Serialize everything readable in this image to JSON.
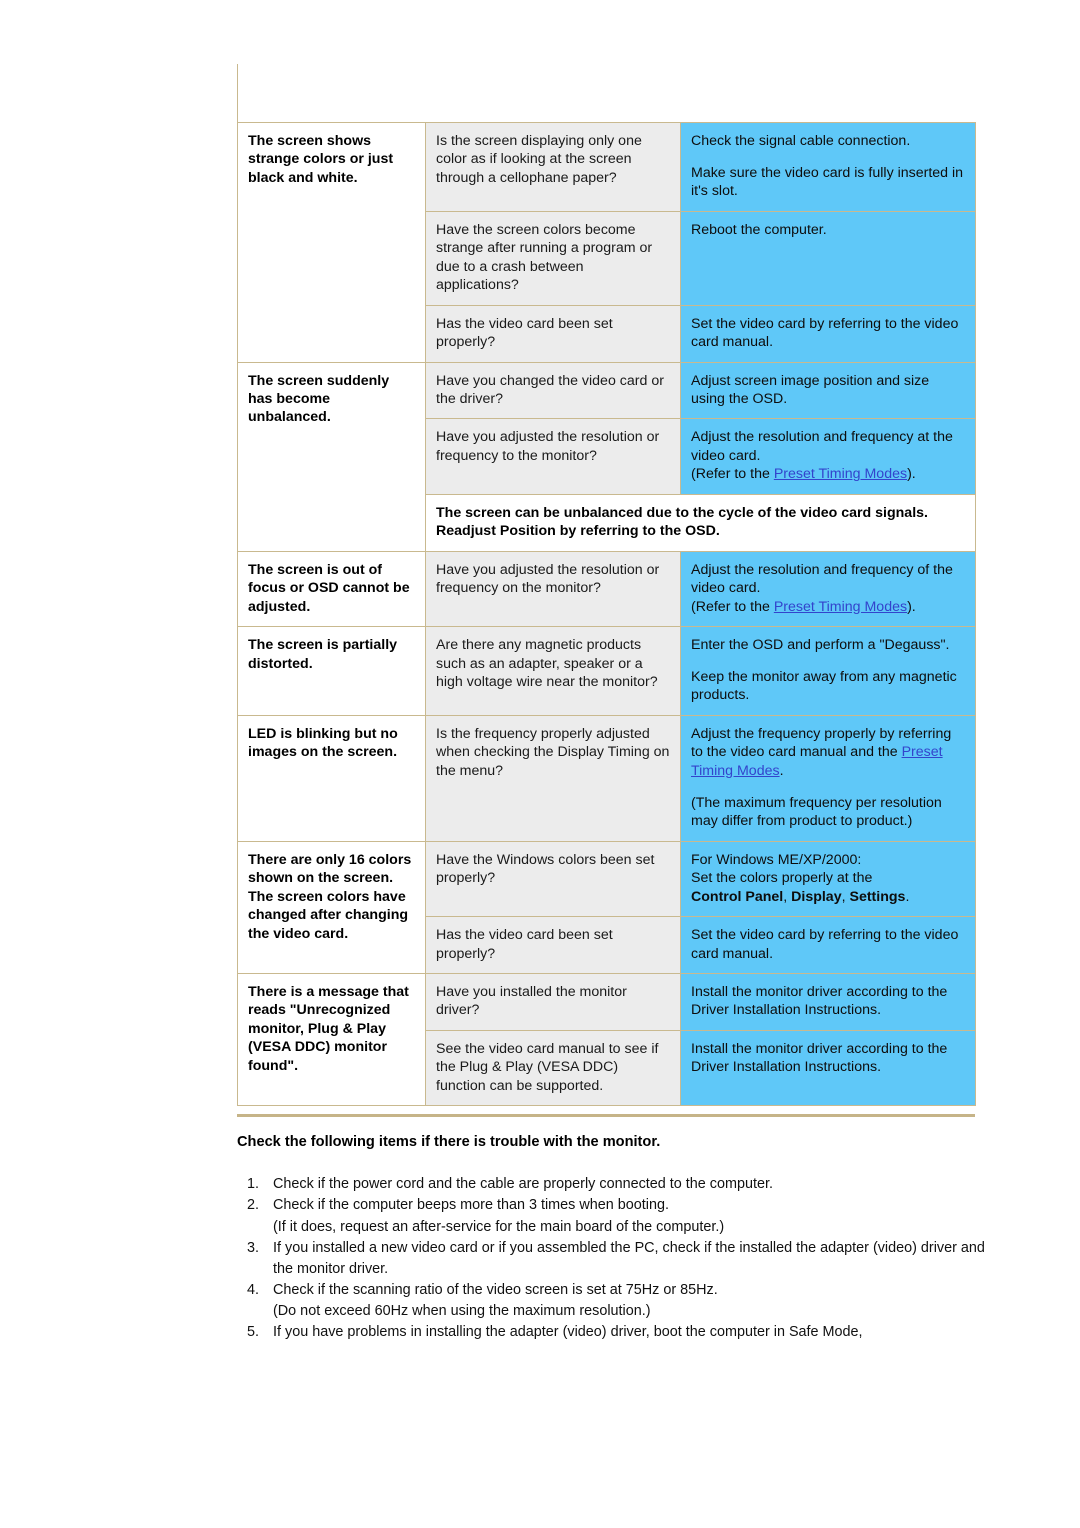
{
  "document": {
    "section_note": "Check the following items if there is trouble with the monitor."
  },
  "table": {
    "link_label": "Preset Timing Modes",
    "rows": [
      {
        "symptom": "The screen shows strange colors or just black and white.",
        "symptom_rowspan": 3,
        "checks": [
          {
            "check": "Is the screen displaying only one color as if looking at the screen through a cellophane paper?",
            "solution_lines": [
              "Check the signal cable connection.",
              "Make sure the video card is fully inserted in it's slot."
            ]
          },
          {
            "check": "Have the screen colors become strange after running a program or due to a crash between applications?",
            "solution_lines": [
              "Reboot the computer."
            ]
          },
          {
            "check": "Has the video card been set properly?",
            "solution_lines": [
              "Set the video card by referring to the video card manual."
            ]
          }
        ]
      },
      {
        "symptom": "The screen suddenly has become unbalanced.",
        "symptom_rowspan": 3,
        "checks": [
          {
            "check": "Have you changed the video card or the driver?",
            "solution_lines": [
              "Adjust screen image position and size using the OSD."
            ]
          },
          {
            "check": "Have you adjusted the resolution or frequency to the monitor?",
            "solution_pre": "Adjust the resolution and frequency at the video card.",
            "solution_refer_prefix": "(Refer to the ",
            "solution_refer_suffix": ")."
          },
          {
            "spanning_note": "The screen can be unbalanced due to the cycle of the video card signals. Readjust Position by referring to the OSD."
          }
        ]
      },
      {
        "symptom": "The screen is out of focus or OSD cannot be adjusted.",
        "symptom_rowspan": 1,
        "checks": [
          {
            "check": "Have you adjusted the resolution or frequency on the monitor?",
            "solution_pre": "Adjust the resolution and frequency of the video card.",
            "solution_refer_prefix": "(Refer to the ",
            "solution_refer_suffix": ")."
          }
        ]
      },
      {
        "symptom": "The screen is partially distorted.",
        "symptom_rowspan": 1,
        "checks": [
          {
            "check": "Are there any magnetic products such as an adapter, speaker or a high voltage wire near the monitor?",
            "solution_lines": [
              "Enter the OSD and perform a \"Degauss\".",
              "Keep the monitor away from any magnetic products."
            ]
          }
        ]
      },
      {
        "symptom": "LED is blinking but no images on the screen.",
        "symptom_rowspan": 1,
        "checks": [
          {
            "check": "Is the frequency properly adjusted when checking the Display Timing on the menu?",
            "solution_pre": "Adjust the frequency properly by referring to the video card manual and the ",
            "solution_link_suffix": ".",
            "solution_post": "(The maximum frequency per resolution may differ from product to product.)"
          }
        ]
      },
      {
        "symptom": "There are only 16 colors shown on the screen. The screen colors have changed after changing the video card.",
        "symptom_rowspan": 2,
        "checks": [
          {
            "check": "Have the Windows colors been set properly?",
            "solution_os_line": "For Windows ME/XP/2000:",
            "solution_set_line": "Set the colors properly at the",
            "solution_bold_items": [
              "Control Panel",
              "Display",
              "Settings"
            ],
            "solution_bold_end": "."
          },
          {
            "check": "Has the video card been set properly?",
            "solution_lines": [
              "Set the video card by referring to the video card manual."
            ]
          }
        ]
      },
      {
        "symptom": "There is a message that reads \"Unrecognized monitor, Plug & Play (VESA DDC) monitor found\".",
        "symptom_rowspan": 2,
        "checks": [
          {
            "check": "Have you installed the monitor driver?",
            "solution_lines": [
              "Install the monitor driver according to the Driver Installation Instructions."
            ]
          },
          {
            "check": "See the video card manual to see if the Plug & Play (VESA DDC) function can be supported.",
            "solution_lines": [
              "Install the monitor driver according to the Driver Installation Instructions."
            ]
          }
        ]
      }
    ]
  },
  "checklist": [
    {
      "main": "Check if the power cord and the cable are properly connected to the computer.",
      "sub": ""
    },
    {
      "main": "Check if the computer beeps more than 3 times when booting.",
      "sub": "(If it does, request an after-service for the main board of the computer.)"
    },
    {
      "main": "If you installed a new video card or if you assembled the PC, check if the installed the adapter (video) driver and the monitor driver.",
      "sub": ""
    },
    {
      "main": "Check if the scanning ratio of the video screen is set at 75Hz or 85Hz.",
      "sub": "(Do not exceed 60Hz when using the maximum resolution.)"
    },
    {
      "main": "If you have problems in installing the adapter (video) driver, boot the computer in Safe Mode,",
      "sub": ""
    }
  ],
  "colors": {
    "solution_bg": "#5fc8f8",
    "check_bg": "#ececec",
    "border": "#c9b98f",
    "link": "#3344cc"
  }
}
